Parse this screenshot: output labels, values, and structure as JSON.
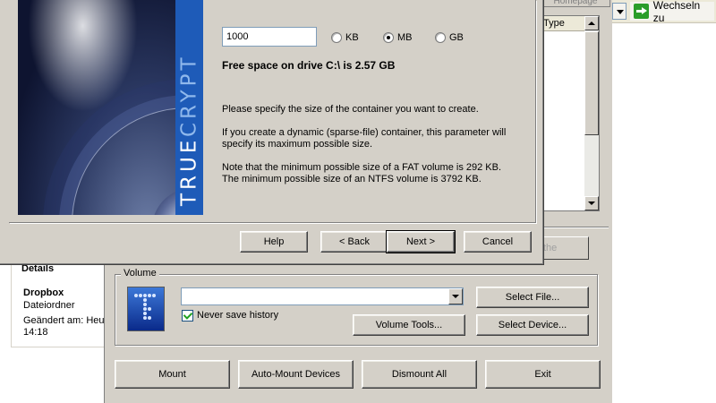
{
  "explorer": {
    "go_label": "Wechseln zu",
    "details_heading": "Details",
    "item_name": "Dropbox",
    "item_type": "Dateiordner",
    "modified": "Geändert am: Heute",
    "time": "14:18"
  },
  "main": {
    "tab_fragment": "Homepage",
    "column_header": "Type",
    "button_fragment": "the",
    "volume_legend": "Volume",
    "volume_path": "",
    "never_save_history": "Never save history",
    "select_file": "Select File...",
    "volume_tools": "Volume Tools...",
    "select_device": "Select Device...",
    "mount": "Mount",
    "auto_mount": "Auto-Mount Devices",
    "dismount_all": "Dismount All",
    "exit": "Exit"
  },
  "wizard": {
    "brand_true": "TRUE",
    "brand_crypt": "CRYPT",
    "size_value": "1000",
    "unit_kb": "KB",
    "unit_mb": "MB",
    "unit_gb": "GB",
    "free_space": "Free space on drive C:\\ is 2.57 GB",
    "para1": "Please specify the size of the container you want to create.",
    "para2_line1": "If you create a dynamic (sparse-file) container, this parameter will",
    "para2_line2": "specify its maximum possible size.",
    "para3_line1": "Note that the minimum possible size of a FAT volume is 292 KB.",
    "para3_line2": "The minimum possible size of an NTFS volume is 3792 KB.",
    "help": "Help",
    "back": "< Back",
    "next": "Next >",
    "cancel": "Cancel"
  },
  "icons": {
    "go": "green-arrow-icon",
    "truecrypt_logo": "truecrypt-key-icon"
  },
  "colors": {
    "dialog_bg": "#d4d0c8",
    "brand_band": "#1e5bb8"
  }
}
